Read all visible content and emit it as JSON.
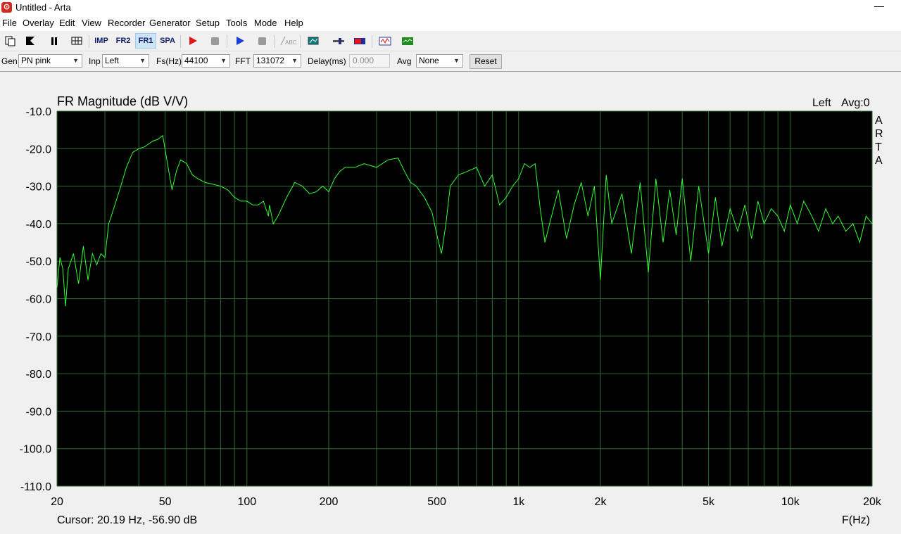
{
  "window": {
    "title": "Untitled - Arta",
    "minimize": "—"
  },
  "menu": [
    "File",
    "Overlay",
    "Edit",
    "View",
    "Recorder",
    "Generator",
    "Setup",
    "Tools",
    "Mode",
    "Help"
  ],
  "toolbar": {
    "imp": "IMP",
    "fr2": "FR2",
    "fr1": "FR1",
    "spa": "SPA",
    "abc": "ABC"
  },
  "controls": {
    "gen_label": "Gen",
    "gen_value": "PN pink",
    "inp_label": "Inp",
    "inp_value": "Left",
    "fs_label": "Fs(Hz)",
    "fs_value": "44100",
    "fft_label": "FFT",
    "fft_value": "131072",
    "delay_label": "Delay(ms)",
    "delay_value": "0.000",
    "avg_label": "Avg",
    "avg_value": "None",
    "reset_label": "Reset"
  },
  "plot": {
    "title": "FR Magnitude (dB V/V)",
    "channel": "Left",
    "avg": "Avg:0",
    "side_letters": [
      "A",
      "R",
      "T",
      "A"
    ],
    "cursor": "Cursor: 20.19 Hz, -56.90 dB",
    "x_unit": "F(Hz)"
  },
  "chart_data": {
    "type": "line",
    "title": "FR Magnitude (dB V/V)",
    "xlabel": "F(Hz)",
    "ylabel": "",
    "xscale": "log",
    "xlim": [
      20,
      20000
    ],
    "ylim": [
      -110,
      -10
    ],
    "grid": true,
    "background": "#000000",
    "line_color": "#33ff33",
    "grid_color": "#2f6b3a",
    "x_ticks": [
      20,
      50,
      100,
      200,
      500,
      1000,
      2000,
      5000,
      10000,
      20000
    ],
    "x_tick_labels": [
      "20",
      "50",
      "100",
      "200",
      "500",
      "1k",
      "2k",
      "5k",
      "10k",
      "20k"
    ],
    "y_ticks": [
      -10,
      -20,
      -30,
      -40,
      -50,
      -60,
      -70,
      -80,
      -90,
      -100,
      -110
    ],
    "y_tick_labels": [
      "-10.0",
      "-20.0",
      "-30.0",
      "-40.0",
      "-50.0",
      "-60.0",
      "-70.0",
      "-80.0",
      "-90.0",
      "-100.0",
      "-110.0"
    ],
    "series": [
      {
        "x": [
          20,
          20.5,
          21,
          21.5,
          22,
          23,
          24,
          25,
          26,
          27,
          28,
          29,
          30,
          31,
          32,
          33,
          34,
          35,
          36,
          38,
          40,
          42,
          45,
          47,
          49,
          51,
          53,
          55,
          57,
          60,
          63,
          66,
          70,
          75,
          80,
          85,
          90,
          95,
          100,
          105,
          110,
          115,
          120,
          121,
          125,
          130,
          140,
          150,
          160,
          170,
          180,
          190,
          200,
          210,
          220,
          230,
          250,
          270,
          300,
          330,
          360,
          380,
          400,
          420,
          450,
          480,
          500,
          520,
          540,
          560,
          600,
          650,
          700,
          750,
          800,
          850,
          900,
          950,
          1000,
          1050,
          1100,
          1150,
          1200,
          1250,
          1300,
          1400,
          1500,
          1600,
          1700,
          1800,
          1900,
          2000,
          2100,
          2200,
          2400,
          2600,
          2800,
          3000,
          3200,
          3400,
          3600,
          3800,
          4000,
          4300,
          4600,
          5000,
          5300,
          5600,
          6000,
          6400,
          6800,
          7200,
          7600,
          8000,
          8500,
          9000,
          9500,
          10000,
          10600,
          11200,
          12000,
          12700,
          13500,
          14300,
          15000,
          16000,
          17000,
          18000,
          19000,
          20000
        ],
        "y": [
          -57,
          -49,
          -52,
          -62,
          -52,
          -48,
          -56,
          -46,
          -55,
          -48,
          -51,
          -48,
          -49,
          -40,
          -37,
          -34,
          -31,
          -28,
          -25,
          -21,
          -20,
          -19.5,
          -18,
          -17.5,
          -16.5,
          -24,
          -31,
          -26,
          -23,
          -24,
          -27,
          -28,
          -29,
          -29.5,
          -30,
          -31,
          -33,
          -34,
          -34,
          -35,
          -35,
          -34,
          -38,
          -35,
          -40,
          -38,
          -33,
          -29,
          -30,
          -32,
          -31.5,
          -30,
          -31.5,
          -28,
          -26,
          -25,
          -25,
          -24,
          -25,
          -23,
          -22.5,
          -26,
          -29,
          -30,
          -33,
          -37,
          -43,
          -48,
          -40,
          -30,
          -27,
          -26,
          -25,
          -30,
          -27,
          -35,
          -33,
          -30,
          -28,
          -24,
          -25,
          -24,
          -36,
          -45,
          -40,
          -31,
          -44,
          -35,
          -29,
          -38,
          -30,
          -55,
          -27,
          -40,
          -32,
          -48,
          -29,
          -53,
          -28,
          -45,
          -31,
          -43,
          -28,
          -50,
          -30,
          -48,
          -33,
          -46,
          -36,
          -42,
          -35,
          -44,
          -34,
          -40,
          -36,
          -38,
          -42,
          -35,
          -40,
          -34,
          -38,
          -42,
          -36,
          -40,
          -38,
          -42,
          -40,
          -45,
          -38,
          -40
        ]
      }
    ]
  }
}
